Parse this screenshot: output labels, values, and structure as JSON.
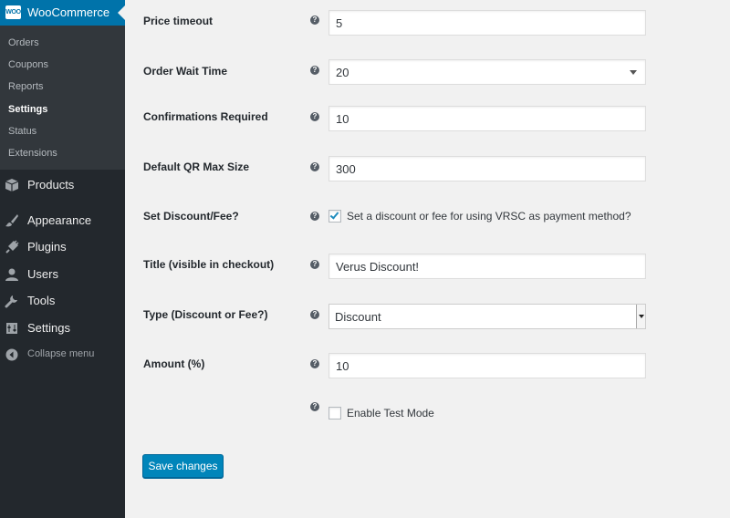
{
  "sidebar": {
    "brand": {
      "logo_text": "WOO",
      "title": "WooCommerce"
    },
    "submenu": [
      {
        "label": "Orders",
        "current": false
      },
      {
        "label": "Coupons",
        "current": false
      },
      {
        "label": "Reports",
        "current": false
      },
      {
        "label": "Settings",
        "current": true
      },
      {
        "label": "Status",
        "current": false
      },
      {
        "label": "Extensions",
        "current": false
      }
    ],
    "menu": [
      {
        "label": "Products",
        "icon": "box-icon"
      },
      {
        "label": "Appearance",
        "icon": "paintbrush-icon"
      },
      {
        "label": "Plugins",
        "icon": "plugin-icon"
      },
      {
        "label": "Users",
        "icon": "user-icon"
      },
      {
        "label": "Tools",
        "icon": "wrench-icon"
      },
      {
        "label": "Settings",
        "icon": "settings-icon"
      }
    ],
    "collapse_label": "Collapse menu"
  },
  "settings": {
    "help_glyph": "?",
    "price_timeout": {
      "label": "Price timeout",
      "value": "5"
    },
    "order_wait_time": {
      "label": "Order Wait Time",
      "value": "20"
    },
    "confirmations_required": {
      "label": "Confirmations Required",
      "value": "10"
    },
    "default_qr_max_size": {
      "label": "Default QR Max Size",
      "value": "300"
    },
    "set_discount_fee": {
      "label": "Set Discount/Fee?",
      "checkbox_label": "Set a discount or fee for using VRSC as payment method?",
      "checked": true
    },
    "title": {
      "label": "Title (visible in checkout)",
      "value": "Verus Discount!"
    },
    "type": {
      "label": "Type (Discount or Fee?)",
      "value": "Discount"
    },
    "amount": {
      "label": "Amount (%)",
      "value": "10"
    },
    "test_mode": {
      "checkbox_label": "Enable Test Mode",
      "checked": false
    }
  },
  "save_button_label": "Save changes",
  "colors": {
    "accent": "#0073aa",
    "sidebar_bg": "#23282d",
    "submenu_bg": "#32373c",
    "button": "#0085ba",
    "checkmark": "#1e8cbe"
  }
}
